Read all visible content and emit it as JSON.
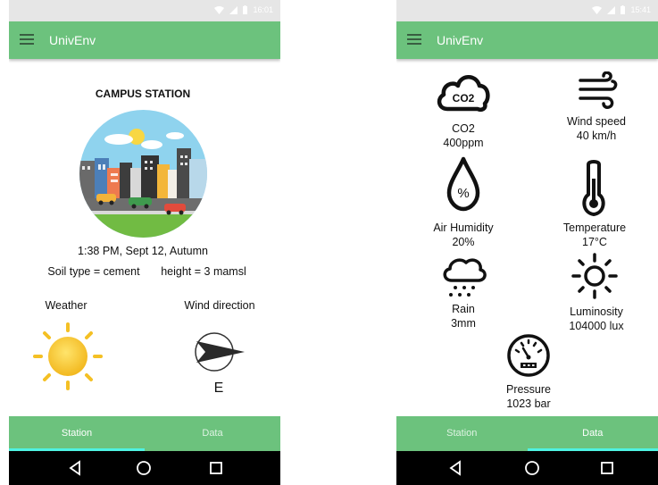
{
  "status_bar": {
    "left_time": "16:01",
    "right_time": "15:41"
  },
  "app": {
    "title": "UnivEnv"
  },
  "station": {
    "title": "CAMPUS STATION",
    "datetime": "1:38 PM, Sept 12, Autumn",
    "soil": "Soil type = cement",
    "height": "height = 3 mamsl",
    "weather_label": "Weather",
    "wind_direction_label": "Wind direction",
    "wind_direction_value": "E"
  },
  "data_screen": {
    "items": [
      {
        "name": "CO2",
        "value": "400ppm",
        "icon": "co2-cloud-icon"
      },
      {
        "name": "Wind speed",
        "value": "40 km/h",
        "icon": "wind-icon"
      },
      {
        "name": "Air Humidity",
        "value": "20%",
        "icon": "humidity-drop-icon"
      },
      {
        "name": "Temperature",
        "value": "17°C",
        "icon": "thermometer-icon"
      },
      {
        "name": "Rain",
        "value": "3mm",
        "icon": "rain-cloud-icon"
      },
      {
        "name": "Luminosity",
        "value": "104000 lux",
        "icon": "sun-outline-icon"
      },
      {
        "name": "Pressure",
        "value": "1023 bar",
        "icon": "gauge-icon"
      }
    ],
    "co2_glyph": "CO2",
    "humidity_glyph": "%"
  },
  "tabs": {
    "station": "Station",
    "data": "Data"
  },
  "colors": {
    "appbar": "#6cc27d",
    "tab_indicator": "#4ff2e2",
    "statusbar": "#e6e6e6",
    "navbar": "#000000"
  }
}
